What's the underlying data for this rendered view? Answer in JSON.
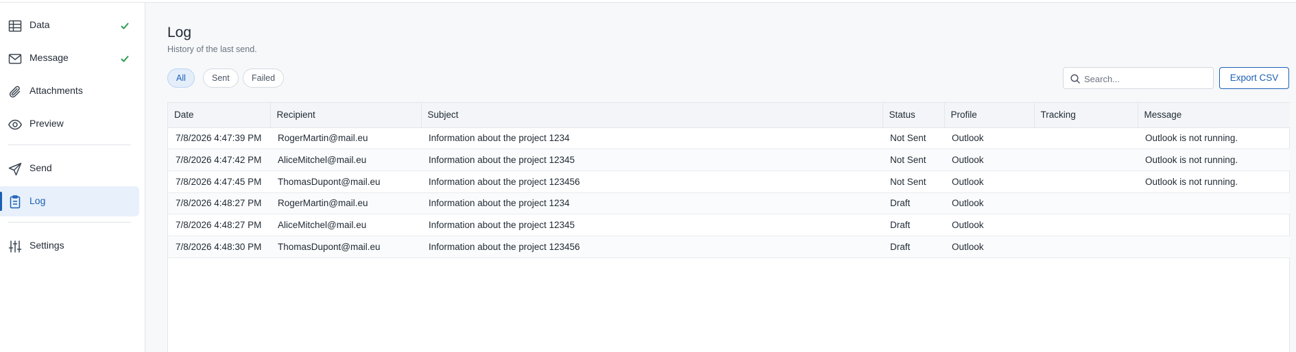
{
  "sidebar": {
    "items": [
      {
        "label": "Data",
        "icon": "table-icon",
        "checked": true
      },
      {
        "label": "Message",
        "icon": "mail-icon",
        "checked": true
      },
      {
        "label": "Attachments",
        "icon": "paperclip-icon",
        "checked": false
      },
      {
        "label": "Preview",
        "icon": "eye-icon",
        "checked": false
      },
      {
        "label": "Send",
        "icon": "send-icon",
        "checked": false
      },
      {
        "label": "Log",
        "icon": "clipboard-icon",
        "checked": false,
        "active": true
      },
      {
        "label": "Settings",
        "icon": "sliders-icon",
        "checked": false
      }
    ]
  },
  "header": {
    "title": "Log",
    "subtitle": "History of the last send."
  },
  "filters": {
    "all": "All",
    "sent": "Sent",
    "failed": "Failed",
    "selected": "All"
  },
  "search": {
    "placeholder": "Search...",
    "value": ""
  },
  "toolbar": {
    "export_label": "Export CSV"
  },
  "colors": {
    "accent": "#1a5fb4",
    "check": "#2e9d4f"
  },
  "table": {
    "columns": [
      "Date",
      "Recipient",
      "Subject",
      "Status",
      "Profile",
      "Tracking",
      "Message"
    ],
    "rows": [
      {
        "date": "7/8/2026 4:47:39 PM",
        "recipient": "RogerMartin@mail.eu",
        "subject": "Information about the project 1234",
        "status": "Not Sent",
        "profile": "Outlook",
        "tracking": "",
        "message": "Outlook is not running."
      },
      {
        "date": "7/8/2026 4:47:42 PM",
        "recipient": "AliceMitchel@mail.eu",
        "subject": "Information about the project 12345",
        "status": "Not Sent",
        "profile": "Outlook",
        "tracking": "",
        "message": "Outlook is not running."
      },
      {
        "date": "7/8/2026 4:47:45 PM",
        "recipient": "ThomasDupont@mail.eu",
        "subject": "Information about the project 123456",
        "status": "Not Sent",
        "profile": "Outlook",
        "tracking": "",
        "message": "Outlook is not running."
      },
      {
        "date": "7/8/2026 4:48:27 PM",
        "recipient": "RogerMartin@mail.eu",
        "subject": "Information about the project 1234",
        "status": "Draft",
        "profile": "Outlook",
        "tracking": "",
        "message": ""
      },
      {
        "date": "7/8/2026 4:48:27 PM",
        "recipient": "AliceMitchel@mail.eu",
        "subject": "Information about the project 12345",
        "status": "Draft",
        "profile": "Outlook",
        "tracking": "",
        "message": ""
      },
      {
        "date": "7/8/2026 4:48:30 PM",
        "recipient": "ThomasDupont@mail.eu",
        "subject": "Information about the project 123456",
        "status": "Draft",
        "profile": "Outlook",
        "tracking": "",
        "message": ""
      }
    ]
  }
}
